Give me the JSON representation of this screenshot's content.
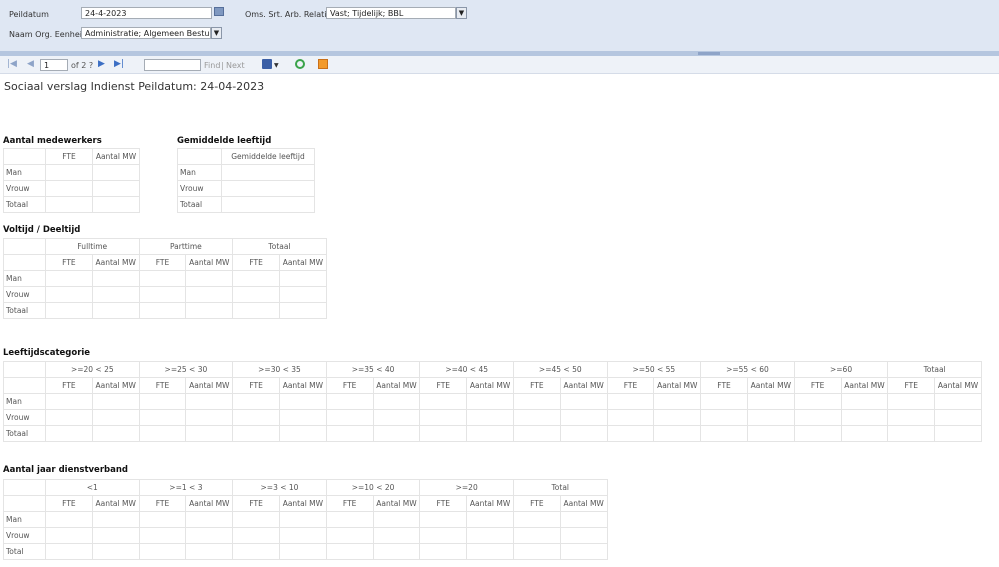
{
  "params": {
    "peildatum_label": "Peildatum",
    "peildatum_value": "24-4-2023",
    "relatie_label": "Oms. Srt. Arb. Relatie",
    "relatie_value": "Vast; Tijdelijk; BBL",
    "org_label": "Naam Org. Eenheid",
    "org_value": "Administratie; Algemeen Bestuur; A"
  },
  "toolbar": {
    "page": "1",
    "of_pages": "of 2 ?",
    "find_placeholder": "",
    "find": "Find",
    "separator": "|",
    "next": "Next"
  },
  "report": {
    "title": "Sociaal verslag Indienst Peildatum: 24-04-2023",
    "rows": [
      "Man",
      "Vrouw",
      "Totaal"
    ],
    "aantal": {
      "title": "Aantal medewerkers",
      "cols": [
        "FTE",
        "Aantal MW"
      ]
    },
    "leeftijd": {
      "title": "Gemiddelde leeftijd",
      "cols": [
        "Gemiddelde leeftijd"
      ]
    },
    "voltijd": {
      "title": "Voltijd / Deeltijd",
      "groups": [
        "Fulltime",
        "Parttime",
        "Totaal"
      ],
      "sub": [
        "FTE",
        "Aantal MW"
      ]
    },
    "categorie": {
      "title": "Leeftijdscategorie",
      "groups": [
        ">=20 < 25",
        ">=25 < 30",
        ">=30 < 35",
        ">=35 < 40",
        ">=40 < 45",
        ">=45 < 50",
        ">=50 < 55",
        ">=55 < 60",
        ">=60",
        "Totaal"
      ],
      "sub": [
        "FTE",
        "Aantal MW"
      ]
    },
    "dienst": {
      "title": "Aantal jaar dienstverband",
      "rows": [
        "Man",
        "Vrouw",
        "Total"
      ],
      "groups": [
        "<1",
        ">=1 < 3",
        ">=3 < 10",
        ">=10 < 20",
        ">=20",
        "Total"
      ],
      "sub": [
        "FTE",
        "Aantal MW"
      ]
    }
  }
}
